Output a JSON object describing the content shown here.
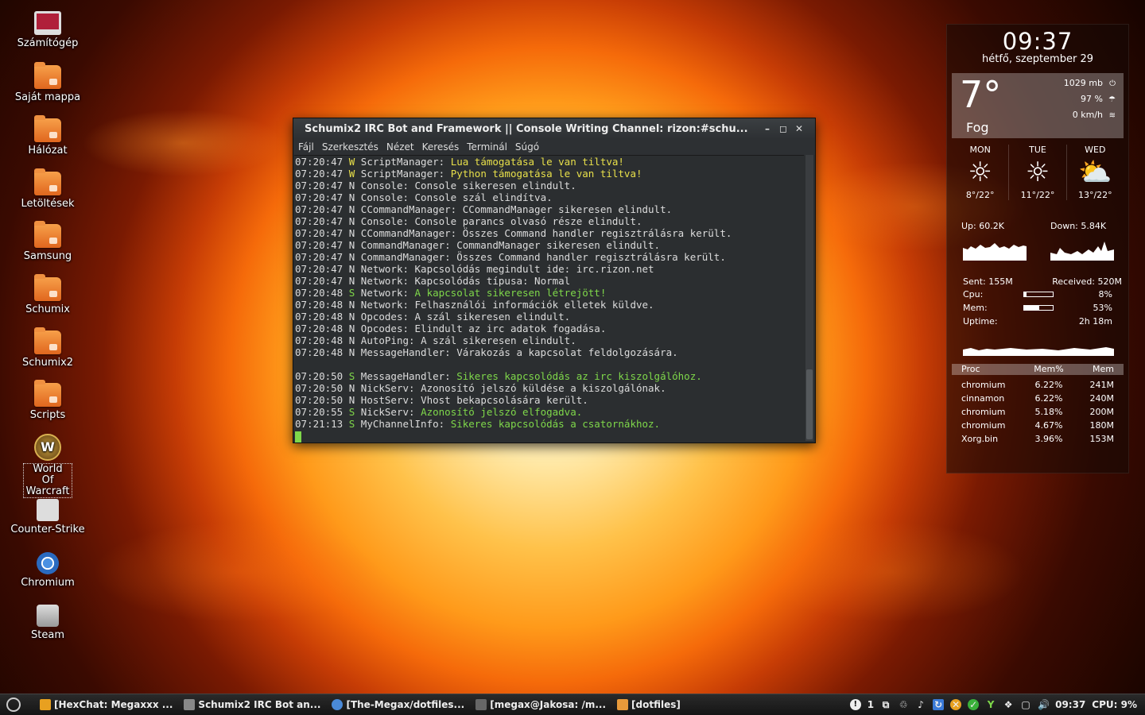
{
  "desktop_icons": [
    {
      "label": "Számítógép",
      "icon": "computer-icon"
    },
    {
      "label": "Saját mappa",
      "icon": "home-folder-icon"
    },
    {
      "label": "Hálózat",
      "icon": "network-folder-icon"
    },
    {
      "label": "Letöltések",
      "icon": "folder-icon"
    },
    {
      "label": "Samsung",
      "icon": "folder-icon"
    },
    {
      "label": "Schumix",
      "icon": "folder-icon"
    },
    {
      "label": "Schumix2",
      "icon": "folder-icon"
    },
    {
      "label": "Scripts",
      "icon": "folder-icon"
    },
    {
      "label": "World Of Warcraft",
      "icon": "wow-icon"
    },
    {
      "label": "Counter-Strike",
      "icon": "counter-strike-icon"
    },
    {
      "label": "Chromium",
      "icon": "chromium-icon"
    },
    {
      "label": "Steam",
      "icon": "steam-icon"
    }
  ],
  "terminal": {
    "title": "Schumix2 IRC Bot and Framework || Console Writing Channel: rizon:#schu...",
    "menu": [
      "Fájl",
      "Szerkesztés",
      "Nézet",
      "Keresés",
      "Terminál",
      "Súgó"
    ],
    "lines": [
      {
        "time": "07:20:47",
        "level": "W",
        "source": "ScriptManager:",
        "msg": "Lua támogatása le van tiltva!",
        "hl": "y"
      },
      {
        "time": "07:20:47",
        "level": "W",
        "source": "ScriptManager:",
        "msg": "Python támogatása le van tiltva!",
        "hl": "y"
      },
      {
        "time": "07:20:47",
        "level": "N",
        "source": "Console:",
        "msg": "Console sikeresen elindult.",
        "hl": ""
      },
      {
        "time": "07:20:47",
        "level": "N",
        "source": "Console:",
        "msg": "Console szál elindítva.",
        "hl": ""
      },
      {
        "time": "07:20:47",
        "level": "N",
        "source": "CCommandManager:",
        "msg": "CCommandManager sikeresen elindult.",
        "hl": ""
      },
      {
        "time": "07:20:47",
        "level": "N",
        "source": "Console:",
        "msg": "Console parancs olvasó része elindult.",
        "hl": ""
      },
      {
        "time": "07:20:47",
        "level": "N",
        "source": "CCommandManager:",
        "msg": "Összes Command handler regisztrálásra került.",
        "hl": ""
      },
      {
        "time": "07:20:47",
        "level": "N",
        "source": "CommandManager:",
        "msg": "CommandManager sikeresen elindult.",
        "hl": ""
      },
      {
        "time": "07:20:47",
        "level": "N",
        "source": "CommandManager:",
        "msg": "Összes Command handler regisztrálásra került.",
        "hl": ""
      },
      {
        "time": "07:20:47",
        "level": "N",
        "source": "Network:",
        "msg": "Kapcsolódás megindult ide: irc.rizon.net",
        "hl": ""
      },
      {
        "time": "07:20:47",
        "level": "N",
        "source": "Network:",
        "msg": "Kapcsolódás típusa: Normal",
        "hl": ""
      },
      {
        "time": "07:20:48",
        "level": "S",
        "source": "Network:",
        "msg": "A kapcsolat sikeresen létrejött!",
        "hl": "g"
      },
      {
        "time": "07:20:48",
        "level": "N",
        "source": "Network:",
        "msg": "Felhasználói információk elletek küldve.",
        "hl": ""
      },
      {
        "time": "07:20:48",
        "level": "N",
        "source": "Opcodes:",
        "msg": "A szál sikeresen elindult.",
        "hl": ""
      },
      {
        "time": "07:20:48",
        "level": "N",
        "source": "Opcodes:",
        "msg": "Elindult az irc adatok fogadása.",
        "hl": ""
      },
      {
        "time": "07:20:48",
        "level": "N",
        "source": "AutoPing:",
        "msg": "A szál sikeresen elindult.",
        "hl": ""
      },
      {
        "time": "07:20:48",
        "level": "N",
        "source": "MessageHandler:",
        "msg": "Várakozás a kapcsolat feldolgozására.",
        "hl": ""
      },
      {
        "time": "",
        "level": "",
        "source": "",
        "msg": "",
        "hl": ""
      },
      {
        "time": "07:20:50",
        "level": "S",
        "source": "MessageHandler:",
        "msg": "Sikeres kapcsolódás az irc kiszolgálóhoz.",
        "hl": "g"
      },
      {
        "time": "07:20:50",
        "level": "N",
        "source": "NickServ:",
        "msg": "Azonosító jelszó küldése a kiszolgálónak.",
        "hl": ""
      },
      {
        "time": "07:20:50",
        "level": "N",
        "source": "HostServ:",
        "msg": "Vhost bekapcsolására került.",
        "hl": ""
      },
      {
        "time": "07:20:55",
        "level": "S",
        "source": "NickServ:",
        "msg": "Azonosító jelszó elfogadva.",
        "hl": "g"
      },
      {
        "time": "07:21:13",
        "level": "S",
        "source": "MyChannelInfo:",
        "msg": "Sikeres kapcsolódás a csatornákhoz.",
        "hl": "g"
      }
    ]
  },
  "clock": {
    "time": "09:37",
    "date": "hétfő, szeptember 29"
  },
  "weather": {
    "temp": "7°",
    "condition": "Fog",
    "pressure": "1029 mb",
    "humidity": "97 %",
    "wind": "0 km/h",
    "forecast": [
      {
        "day": "MON",
        "range": "8°/22°",
        "icon": "sun-icon"
      },
      {
        "day": "TUE",
        "range": "11°/22°",
        "icon": "sun-icon"
      },
      {
        "day": "WED",
        "range": "13°/22°",
        "icon": "partly-cloudy-icon"
      }
    ]
  },
  "network": {
    "up": "Up: 60.2K",
    "down": "Down: 5.84K",
    "sent": "Sent: 155M",
    "received": "Received: 520M"
  },
  "system": {
    "cpu_label": "Cpu:",
    "cpu": "8%",
    "cpu_fraction": 0.08,
    "mem_label": "Mem:",
    "mem": "53%",
    "mem_fraction": 0.53,
    "uptime_label": "Uptime:",
    "uptime": "2h 18m"
  },
  "processes": {
    "headers": [
      "Proc",
      "Mem%",
      "Mem"
    ],
    "rows": [
      [
        "chromium",
        "6.22%",
        "241M"
      ],
      [
        "cinnamon",
        "6.22%",
        "240M"
      ],
      [
        "chromium",
        "5.18%",
        "200M"
      ],
      [
        "chromium",
        "4.67%",
        "180M"
      ],
      [
        "Xorg.bin",
        "3.96%",
        "153M"
      ]
    ]
  },
  "taskbar": {
    "tasks": [
      {
        "label": "[HexChat: Megaxxx ...",
        "color": "#e8a020"
      },
      {
        "label": "Schumix2 IRC Bot an...",
        "color": "#888"
      },
      {
        "label": "[The-Megax/dotfiles...",
        "color": "#4a8ad8"
      },
      {
        "label": "[megax@Jakosa: /m...",
        "color": "#666"
      },
      {
        "label": "[dotfiles]",
        "color": "#e89a3a"
      }
    ],
    "tray_count": "1",
    "time": "09:37",
    "cpu": "CPU: 9%"
  }
}
